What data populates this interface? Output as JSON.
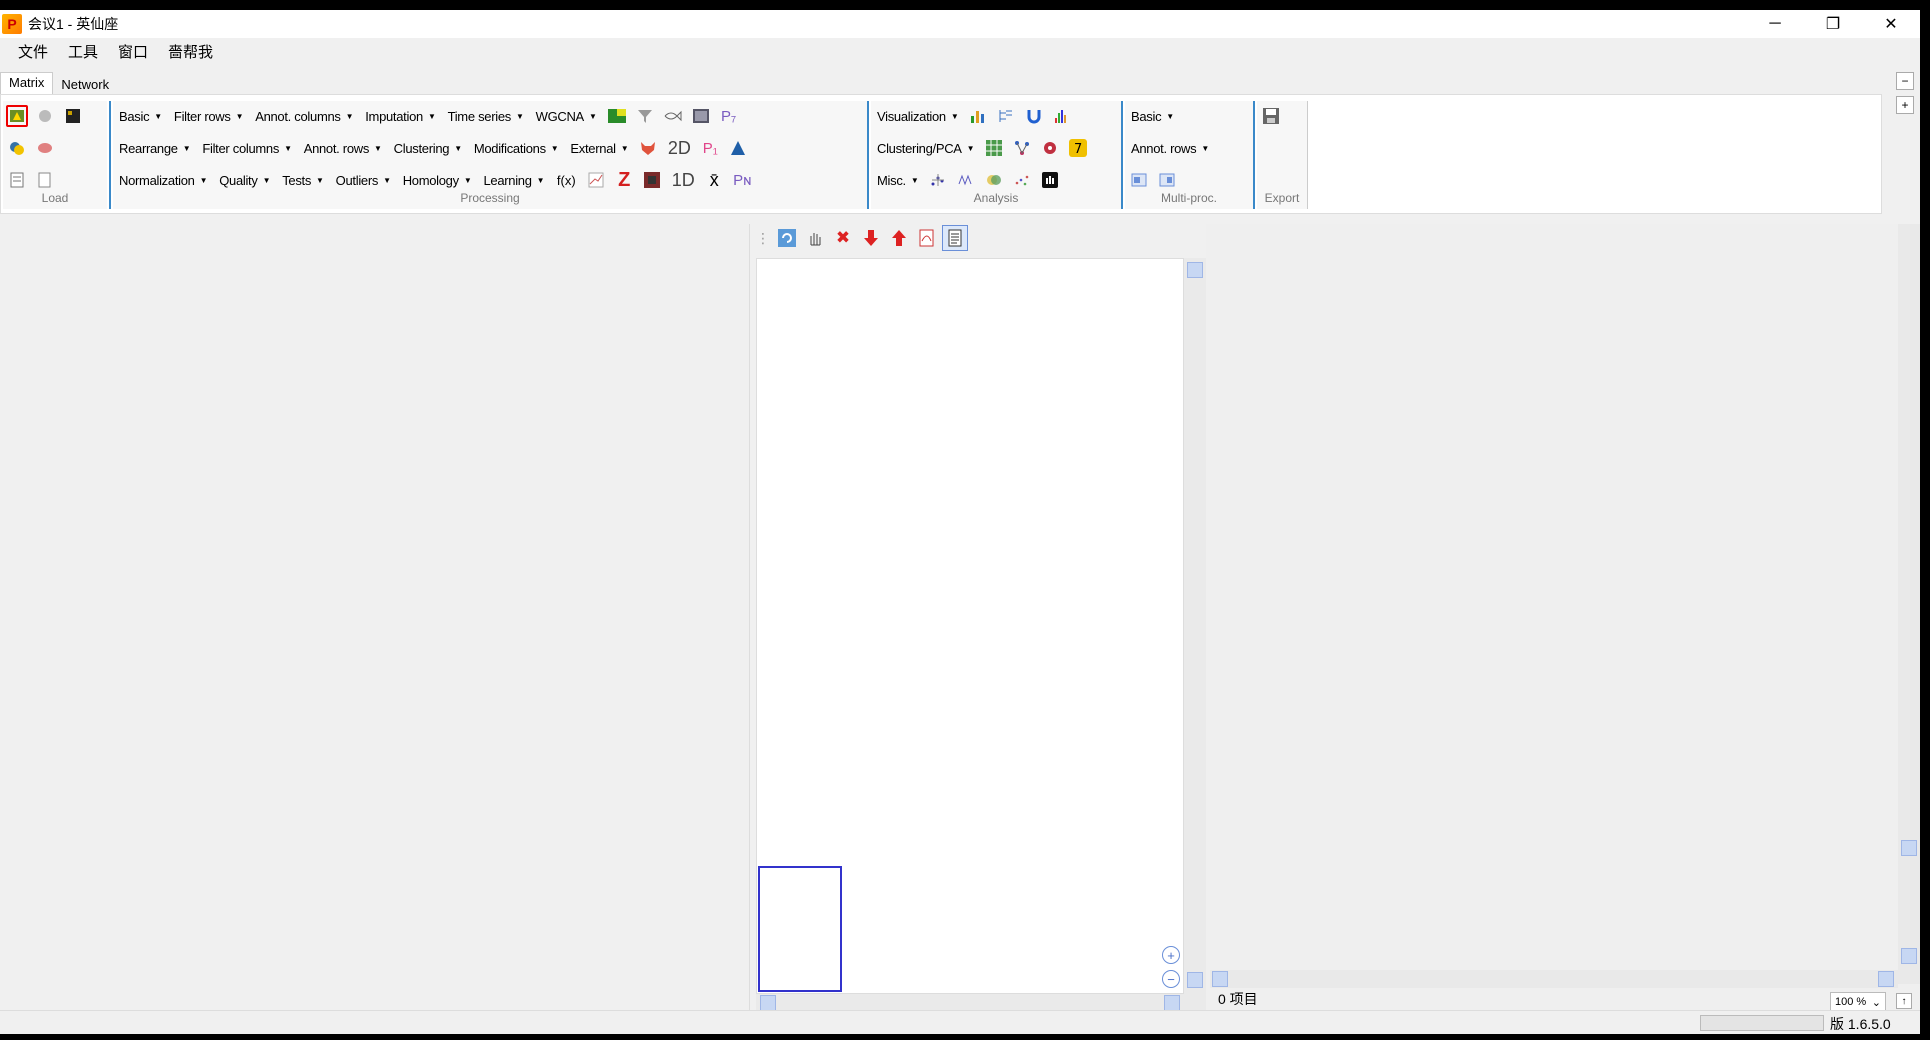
{
  "titlebar": {
    "app_icon_glyph": "P",
    "title": "会议1 - 英仙座",
    "minimize": "─",
    "restore": "❐",
    "close": "✕"
  },
  "menu": [
    "文件",
    "工具",
    "窗口",
    "嗇帮我"
  ],
  "tabs": [
    {
      "label": "Matrix",
      "active": true
    },
    {
      "label": "Network",
      "active": false
    }
  ],
  "side_buttons": {
    "collapse": "−",
    "expand": "+"
  },
  "ribbon": {
    "load": {
      "label": "Load"
    },
    "processing": {
      "label": "Processing",
      "row1": [
        "Basic",
        "Filter rows",
        "Annot. columns",
        "Imputation",
        "Time series",
        "WGCNA"
      ],
      "row2": [
        "Rearrange",
        "Filter columns",
        "Annot. rows",
        "Clustering",
        "Modifications",
        "External"
      ],
      "row3": [
        "Normalization",
        "Quality",
        "Tests",
        "Outliers",
        "Homology",
        "Learning"
      ],
      "row1_icon_text": "P₇",
      "row2_icon_text": [
        "2D",
        "P₁"
      ],
      "row3_icon_text": [
        "f(x)",
        "Z",
        "1D",
        "x̄",
        "Pɴ"
      ]
    },
    "analysis": {
      "label": "Analysis",
      "row1": [
        "Visualization"
      ],
      "row2": [
        "Clustering/PCA"
      ],
      "row3": [
        "Misc."
      ]
    },
    "multiproc": {
      "label": "Multi-proc.",
      "row1": [
        "Basic"
      ],
      "row2": [
        "Annot. rows"
      ]
    },
    "export": {
      "label": "Export"
    }
  },
  "zoom_in": "+",
  "zoom_out": "−",
  "item_count": "0 项目",
  "zoom_level": "100 %",
  "version": "版 1.6.5.0"
}
